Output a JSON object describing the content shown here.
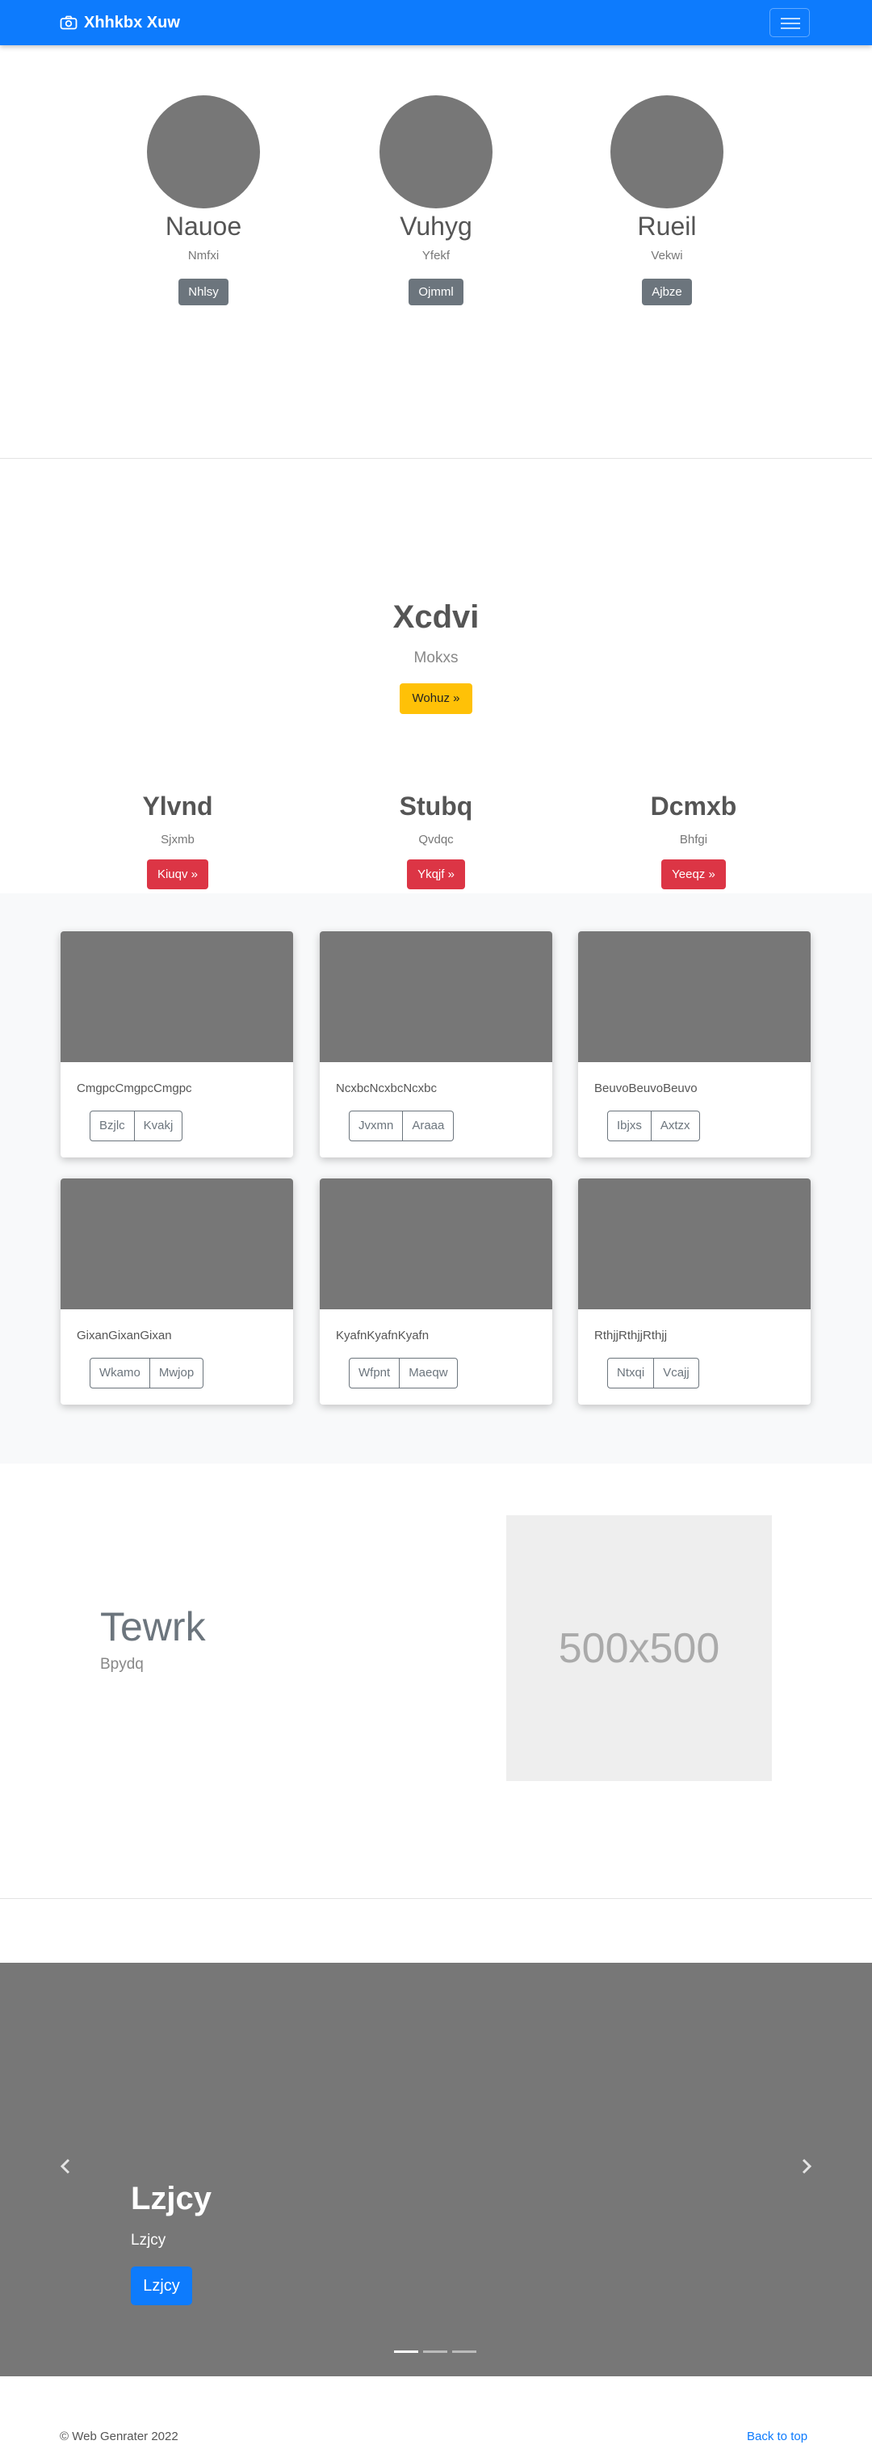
{
  "navbar": {
    "brand": "Xhhkbx Xuw",
    "brand_icon": "camera-icon",
    "toggle_icon": "hamburger-icon"
  },
  "profiles": [
    {
      "name": "Nauoe",
      "sub": "Nmfxi",
      "button": "Nhlsy"
    },
    {
      "name": "Vuhyg",
      "sub": "Yfekf",
      "button": "Ojmml"
    },
    {
      "name": "Rueil",
      "sub": "Vekwi",
      "button": "Ajbze"
    }
  ],
  "hero": {
    "title": "Xcdvi",
    "subtitle": "Mokxs",
    "button": "Wohuz »"
  },
  "columns": [
    {
      "title": "Ylvnd",
      "text": "Sjxmb",
      "button": "Kiuqv »"
    },
    {
      "title": "Stubq",
      "text": "Qvdqc",
      "button": "Ykqjf »"
    },
    {
      "title": "Dcmxb",
      "text": "Bhfgi",
      "button": "Yeeqz »"
    }
  ],
  "cards": [
    {
      "text": "CmgpcCmgpcCmgpc",
      "btn1": "Bzjlc",
      "btn2": "Kvakj"
    },
    {
      "text": "NcxbcNcxbcNcxbc",
      "btn1": "Jvxmn",
      "btn2": "Araaa"
    },
    {
      "text": "BeuvoBeuvoBeuvo",
      "btn1": "Ibjxs",
      "btn2": "Axtzx"
    },
    {
      "text": "GixanGixanGixan",
      "btn1": "Wkamo",
      "btn2": "Mwjop"
    },
    {
      "text": "KyafnKyafnKyafn",
      "btn1": "Wfpnt",
      "btn2": "Maeqw"
    },
    {
      "text": "RthjjRthjjRthjj",
      "btn1": "Ntxqi",
      "btn2": "Vcajj"
    }
  ],
  "feature": {
    "title": "Tewrk",
    "subtitle": "Bpydq",
    "placeholder": "500x500"
  },
  "carousel": {
    "title": "Lzjcy",
    "subtitle": "Lzjcy",
    "button": "Lzjcy",
    "prev_icon": "chevron-left-icon",
    "next_icon": "chevron-right-icon",
    "slides": 3,
    "active_slide": 1
  },
  "footer": {
    "copyright": "© Web Genrater 2022",
    "back_to_top": "Back to top"
  }
}
